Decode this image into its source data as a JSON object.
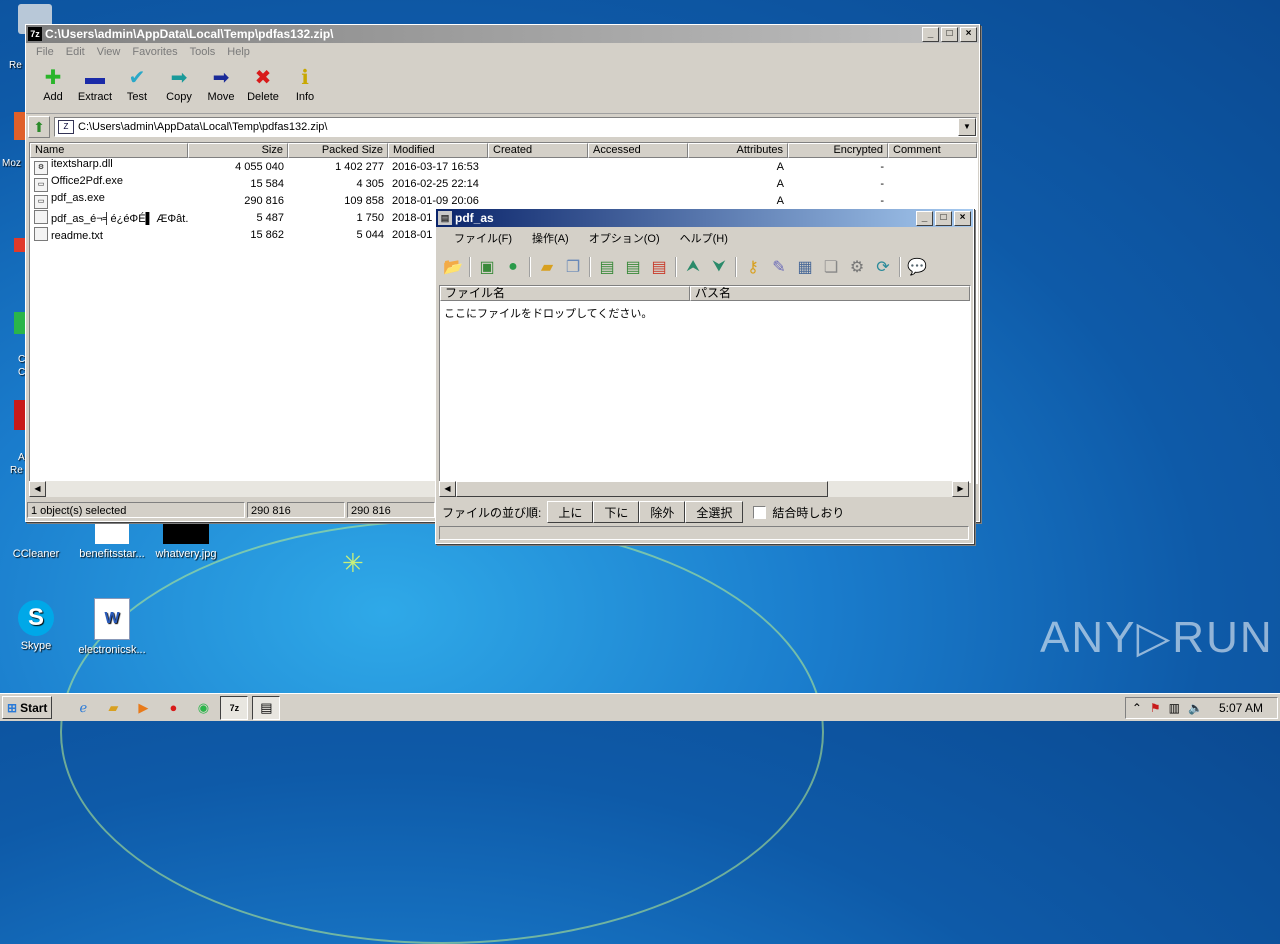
{
  "desktop": {
    "icons": [
      {
        "label": "CCleaner"
      },
      {
        "label": "benefitsstar..."
      },
      {
        "label": "whatvery.jpg"
      },
      {
        "label": "Skype"
      },
      {
        "label": "electronicsk..."
      }
    ],
    "edge_labels": [
      "Re",
      "Moz",
      "C",
      "C",
      "A",
      "Re"
    ],
    "watermark": "ANY▷RUN"
  },
  "sevenzip": {
    "title": "C:\\Users\\admin\\AppData\\Local\\Temp\\pdfas132.zip\\",
    "menu": [
      "File",
      "Edit",
      "View",
      "Favorites",
      "Tools",
      "Help"
    ],
    "toolbar": [
      {
        "label": "Add",
        "icon": "plus-icon",
        "glyph": "✚",
        "color": "#2ab52a"
      },
      {
        "label": "Extract",
        "icon": "minus-icon",
        "glyph": "▬",
        "color": "#1a2aa8"
      },
      {
        "label": "Test",
        "icon": "check-icon",
        "glyph": "✔",
        "color": "#2aa8c8"
      },
      {
        "label": "Copy",
        "icon": "copy-arrow-icon",
        "glyph": "➡",
        "color": "#1a9a9a"
      },
      {
        "label": "Move",
        "icon": "move-arrow-icon",
        "glyph": "➡",
        "color": "#1a2a98"
      },
      {
        "label": "Delete",
        "icon": "delete-icon",
        "glyph": "✖",
        "color": "#d81a1a"
      },
      {
        "label": "Info",
        "icon": "info-icon",
        "glyph": "ℹ",
        "color": "#c8a800"
      }
    ],
    "address": "C:\\Users\\admin\\AppData\\Local\\Temp\\pdfas132.zip\\",
    "columns": [
      "Name",
      "Size",
      "Packed Size",
      "Modified",
      "Created",
      "Accessed",
      "Attributes",
      "Encrypted",
      "Comment"
    ],
    "rows": [
      {
        "name": "itextsharp.dll",
        "size": "4 055 040",
        "packed": "1 402 277",
        "modified": "2016-03-17 16:53",
        "attr": "A",
        "enc": "-"
      },
      {
        "name": "Office2Pdf.exe",
        "size": "15 584",
        "packed": "4 305",
        "modified": "2016-02-25 22:14",
        "attr": "A",
        "enc": "-"
      },
      {
        "name": "pdf_as.exe",
        "size": "290 816",
        "packed": "109 858",
        "modified": "2018-01-09 20:06",
        "attr": "A",
        "enc": "-"
      },
      {
        "name": "pdf_as_é¬╡é¿éΦÉ▌ ÆΦât...",
        "size": "5 487",
        "packed": "1 750",
        "modified": "2018-01",
        "attr": "",
        "enc": ""
      },
      {
        "name": "readme.txt",
        "size": "15 862",
        "packed": "5 044",
        "modified": "2018-01",
        "attr": "",
        "enc": ""
      }
    ],
    "status": [
      "1 object(s) selected",
      "290 816",
      "290 816"
    ]
  },
  "pdfas": {
    "title": "pdf_as",
    "menu": [
      "ファイル(F)",
      "操作(A)",
      "オプション(O)",
      "ヘルプ(H)"
    ],
    "columns": [
      "ファイル名",
      "パス名"
    ],
    "drop_hint": "ここにファイルをドロップしてください。",
    "sort_label": "ファイルの並び順:",
    "buttons": [
      "上に",
      "下に",
      "除外",
      "全選択"
    ],
    "checkbox_label": "結合時しおり"
  },
  "taskbar": {
    "start": "Start",
    "clock": "5:07 AM"
  }
}
